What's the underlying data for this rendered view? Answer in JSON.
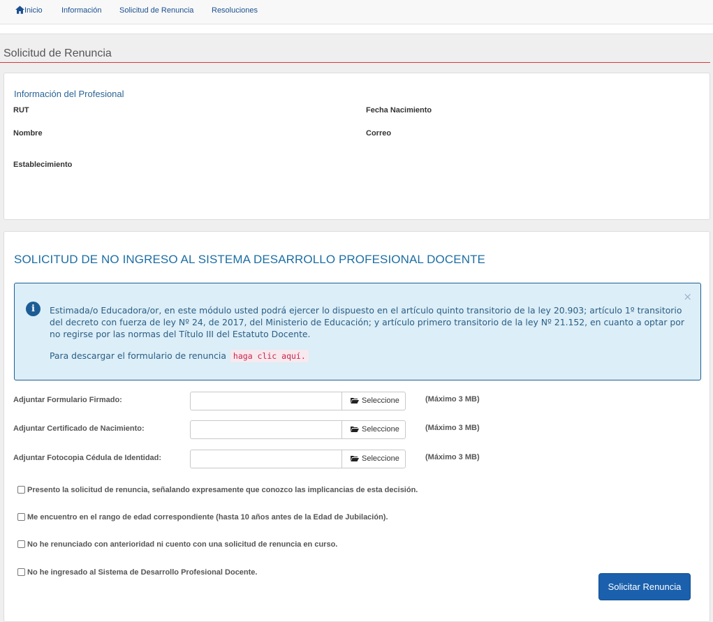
{
  "nav": {
    "items": [
      {
        "label": "Inicio",
        "icon": "home-icon"
      },
      {
        "label": "Información"
      },
      {
        "label": "Solicitud de Renuncia"
      },
      {
        "label": "Resoluciones"
      }
    ]
  },
  "page_title": "Solicitud de Renuncia",
  "profile": {
    "section_title": "Información del Profesional",
    "labels": {
      "rut": "RUT",
      "fecha_nacimiento": "Fecha Nacimiento",
      "nombre": "Nombre",
      "correo": "Correo",
      "establecimiento": "Establecimiento"
    }
  },
  "form": {
    "title": "SOLICITUD DE NO INGRESO AL SISTEMA DESARROLLO PROFESIONAL DOCENTE",
    "alert": {
      "message": "Estimada/o Educadora/or, en este módulo usted podrá ejercer lo dispuesto en el artículo quinto transitorio de la ley 20.903; artículo 1º transitorio del decreto con fuerza de ley Nº 24, de 2017, del Ministerio de Educación; y artículo primero transitorio de la ley Nº 21.152, en cuanto a optar por no regirse por las normas del Título III del Estatuto Docente.",
      "download_text": "Para descargar el formulario de renuncia",
      "download_link": "haga clic aquí.",
      "close": "×",
      "icon": "i"
    },
    "files": [
      {
        "label": "Adjuntar Formulario Firmado:",
        "button": "Seleccione",
        "max": "(Máximo 3 MB)",
        "value": ""
      },
      {
        "label": "Adjuntar Certificado de Nacimiento:",
        "button": "Seleccione",
        "max": "(Máximo 3 MB)",
        "value": ""
      },
      {
        "label": "Adjuntar Fotocopia Cédula de Identidad:",
        "button": "Seleccione",
        "max": "(Máximo 3 MB)",
        "value": ""
      }
    ],
    "checkboxes": [
      {
        "label": "Presento la solicitud de renuncia, señalando expresamente que conozco las implicancias de esta decisión.",
        "checked": false
      },
      {
        "label": "Me encuentro en el rango de edad correspondiente (hasta 10 años antes de la Edad de Jubilación).",
        "checked": false
      },
      {
        "label": "No he renunciado con anterioridad ni cuento con una solicitud de renuncia en curso.",
        "checked": false
      },
      {
        "label": "No he ingresado al Sistema de Desarrollo Profesional Docente.",
        "checked": false
      }
    ],
    "submit_label": "Solicitar Renuncia"
  },
  "colors": {
    "accent": "#1a60ad",
    "rule": "#d9363e",
    "alert_bg": "#dceef7"
  }
}
